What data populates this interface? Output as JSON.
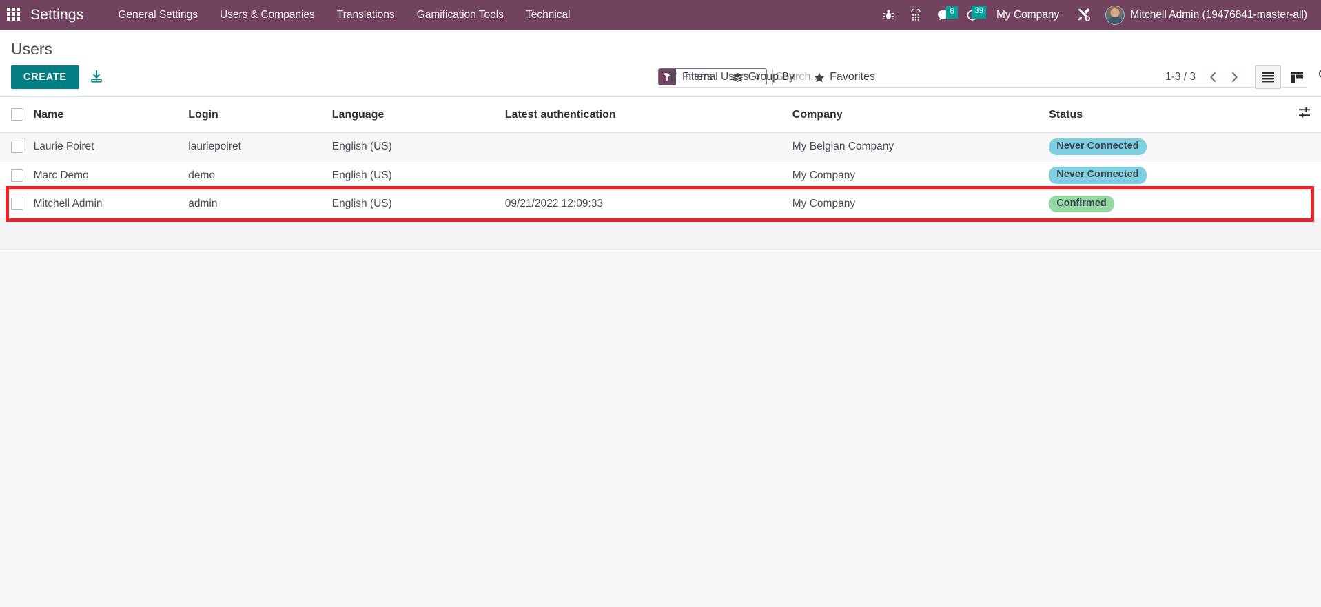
{
  "navbar": {
    "apps_icon": "apps-grid-icon",
    "brand": "Settings",
    "menu_items": [
      {
        "label": "General Settings"
      },
      {
        "label": "Users & Companies"
      },
      {
        "label": "Translations"
      },
      {
        "label": "Gamification Tools"
      },
      {
        "label": "Technical"
      }
    ],
    "icons": [
      {
        "name": "bug-icon",
        "badge": ""
      },
      {
        "name": "dialpad-icon",
        "badge": ""
      },
      {
        "name": "messages-icon",
        "badge": "6"
      },
      {
        "name": "activities-clock-icon",
        "badge": "39"
      }
    ],
    "company": "My Company",
    "tools_icon": "tools-wrench-icon",
    "username": "Mitchell Admin (19476841-master-all)",
    "background_color": "#71435f",
    "badge_color": "#00a09d"
  },
  "control_panel": {
    "title": "Users",
    "create_label": "CREATE",
    "import_icon": "import-icon",
    "create_color": "#017e84",
    "search": {
      "facet_label": "Internal Users",
      "facet_icon": "filter-funnel-icon",
      "facet_remove": "×",
      "placeholder": "Search...",
      "value": "",
      "search_icon": "search-icon"
    },
    "dropdowns": [
      {
        "label": "Filters",
        "icon": "filter-funnel-icon"
      },
      {
        "label": "Group By",
        "icon": "layers-icon"
      },
      {
        "label": "Favorites",
        "icon": "star-icon"
      }
    ],
    "pager": "1-3 / 3",
    "prev_icon": "chevron-left-icon",
    "next_icon": "chevron-right-icon",
    "views": [
      {
        "name": "list-view",
        "icon": "list-icon",
        "active": true
      },
      {
        "name": "kanban-view",
        "icon": "kanban-icon",
        "active": false
      }
    ]
  },
  "table": {
    "columns": [
      "Name",
      "Login",
      "Language",
      "Latest authentication",
      "Company",
      "Status"
    ],
    "optional_columns_icon": "sliders-icon",
    "rows": [
      {
        "name": "Laurie Poiret",
        "login": "lauriepoiret",
        "language": "English (US)",
        "latest_authentication": "",
        "company": "My Belgian Company",
        "status": "Never Connected",
        "status_type": "info"
      },
      {
        "name": "Marc Demo",
        "login": "demo",
        "language": "English (US)",
        "latest_authentication": "",
        "company": "My Company",
        "status": "Never Connected",
        "status_type": "info"
      },
      {
        "name": "Mitchell Admin",
        "login": "admin",
        "language": "English (US)",
        "latest_authentication": "09/21/2022 12:09:33",
        "company": "My Company",
        "status": "Confirmed",
        "status_type": "success"
      }
    ],
    "highlight_row_index": 2,
    "highlight_color": "#ec2227",
    "badge_colors": {
      "info": "#7ed0e0",
      "success": "#94d8a4"
    }
  }
}
